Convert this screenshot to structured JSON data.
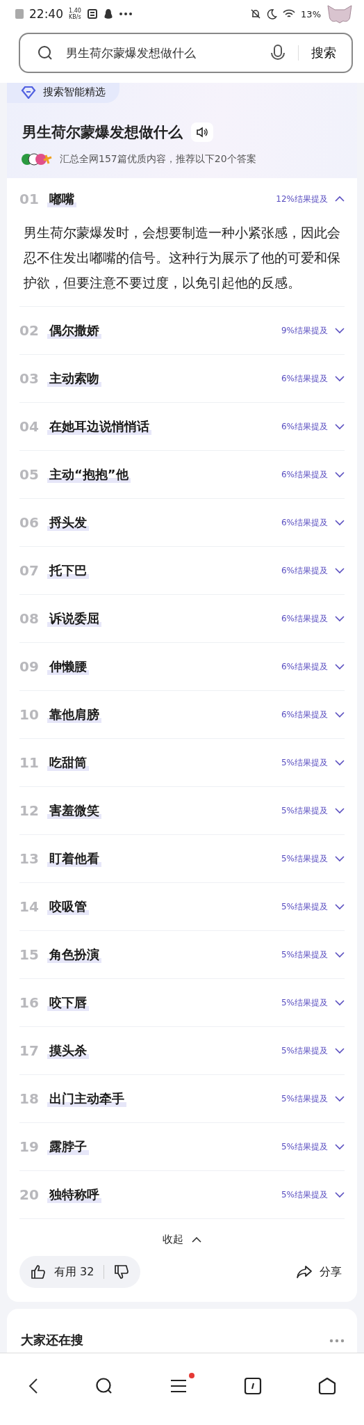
{
  "status_bar": {
    "time": "22:40",
    "speed_value": "1.40",
    "speed_unit": "KB/s",
    "battery": "13%"
  },
  "search": {
    "value": "男生荷尔蒙爆发想做什么",
    "button": "搜索"
  },
  "answer_card": {
    "badge": "搜索智能精选",
    "title": "男生荷尔蒙爆发想做什么",
    "summary": "汇总全网157篇优质内容，推荐以下20个答案",
    "items": [
      {
        "number": "01",
        "label": "嘟嘴",
        "mention": "12%结果提及",
        "expanded": true,
        "detail": "男生荷尔蒙爆发时，会想要制造一种小紧张感，因此会忍不住发出嘟嘴的信号。这种行为展示了他的可爱和保护欲，但要注意不要过度，以免引起他的反感。"
      },
      {
        "number": "02",
        "label": "偶尔撒娇",
        "mention": "9%结果提及",
        "expanded": false
      },
      {
        "number": "03",
        "label": "主动索吻",
        "mention": "6%结果提及",
        "expanded": false
      },
      {
        "number": "04",
        "label": "在她耳边说悄悄话",
        "mention": "6%结果提及",
        "expanded": false
      },
      {
        "number": "05",
        "label": "主动“抱抱”他",
        "mention": "6%结果提及",
        "expanded": false
      },
      {
        "number": "06",
        "label": "捋头发",
        "mention": "6%结果提及",
        "expanded": false
      },
      {
        "number": "07",
        "label": "托下巴",
        "mention": "6%结果提及",
        "expanded": false
      },
      {
        "number": "08",
        "label": "诉说委屈",
        "mention": "6%结果提及",
        "expanded": false
      },
      {
        "number": "09",
        "label": "伸懒腰",
        "mention": "6%结果提及",
        "expanded": false
      },
      {
        "number": "10",
        "label": "靠他肩膀",
        "mention": "6%结果提及",
        "expanded": false
      },
      {
        "number": "11",
        "label": "吃甜筒",
        "mention": "5%结果提及",
        "expanded": false
      },
      {
        "number": "12",
        "label": "害羞微笑",
        "mention": "5%结果提及",
        "expanded": false
      },
      {
        "number": "13",
        "label": "盯着他看",
        "mention": "5%结果提及",
        "expanded": false
      },
      {
        "number": "14",
        "label": "咬吸管",
        "mention": "5%结果提及",
        "expanded": false
      },
      {
        "number": "15",
        "label": "角色扮演",
        "mention": "5%结果提及",
        "expanded": false
      },
      {
        "number": "16",
        "label": "咬下唇",
        "mention": "5%结果提及",
        "expanded": false
      },
      {
        "number": "17",
        "label": "摸头杀",
        "mention": "5%结果提及",
        "expanded": false
      },
      {
        "number": "18",
        "label": "出门主动牵手",
        "mention": "5%结果提及",
        "expanded": false
      },
      {
        "number": "19",
        "label": "露脖子",
        "mention": "5%结果提及",
        "expanded": false
      },
      {
        "number": "20",
        "label": "独特称呼",
        "mention": "5%结果提及",
        "expanded": false
      }
    ],
    "collapse": "收起",
    "useful": "有用 32",
    "share": "分享"
  },
  "related": {
    "title": "大家还在搜"
  },
  "bottom_nav": {
    "menu_notification": true
  }
}
